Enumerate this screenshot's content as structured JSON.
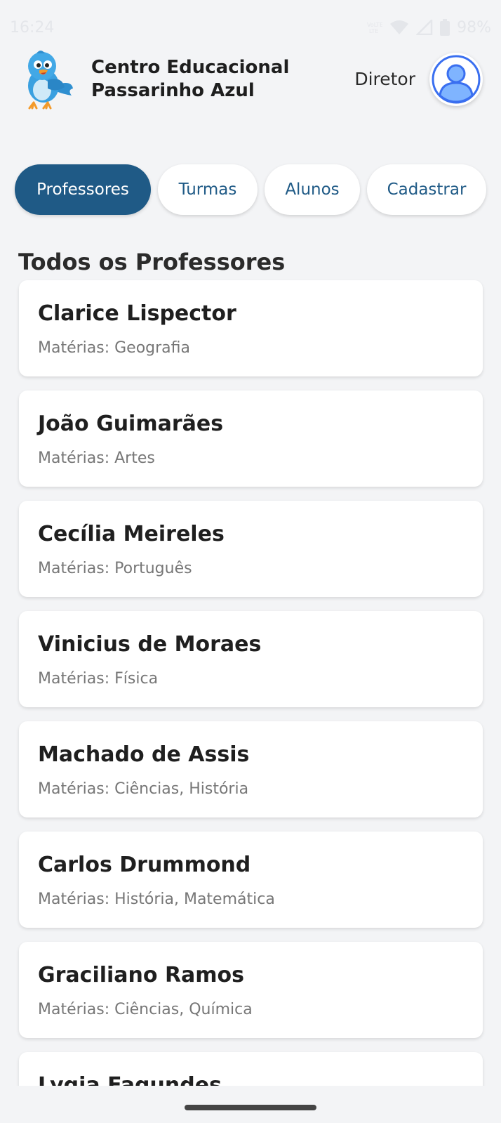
{
  "status_bar": {
    "time": "16:24",
    "battery": "98%",
    "icons": [
      "volte-icon",
      "wifi-icon",
      "signal-icon",
      "battery-icon"
    ]
  },
  "header": {
    "school_name_line1": "Centro Educacional",
    "school_name_line2": "Passarinho Azul",
    "role": "Diretor",
    "logo": "blue-bird-logo",
    "avatar": "user-avatar-icon"
  },
  "tabs": [
    {
      "label": "Professores",
      "active": true
    },
    {
      "label": "Turmas",
      "active": false
    },
    {
      "label": "Alunos",
      "active": false
    },
    {
      "label": "Cadastrar",
      "active": false
    }
  ],
  "section_title": "Todos os Professores",
  "teachers": [
    {
      "name": "Clarice Lispector",
      "subjects": "Matérias: Geografia"
    },
    {
      "name": "João Guimarães",
      "subjects": "Matérias: Artes"
    },
    {
      "name": "Cecília Meireles",
      "subjects": "Matérias: Português"
    },
    {
      "name": "Vinicius de Moraes",
      "subjects": "Matérias: Física"
    },
    {
      "name": "Machado de Assis",
      "subjects": "Matérias: Ciências, História"
    },
    {
      "name": "Carlos Drummond",
      "subjects": "Matérias: História, Matemática"
    },
    {
      "name": "Graciliano Ramos",
      "subjects": "Matérias: Ciências, Química"
    },
    {
      "name": "Lygia Fagundes",
      "subjects": ""
    }
  ],
  "colors": {
    "primary": "#1f5a86",
    "background": "#f3f4f6",
    "card": "#ffffff",
    "avatar_blue": "#3a6ff0"
  }
}
